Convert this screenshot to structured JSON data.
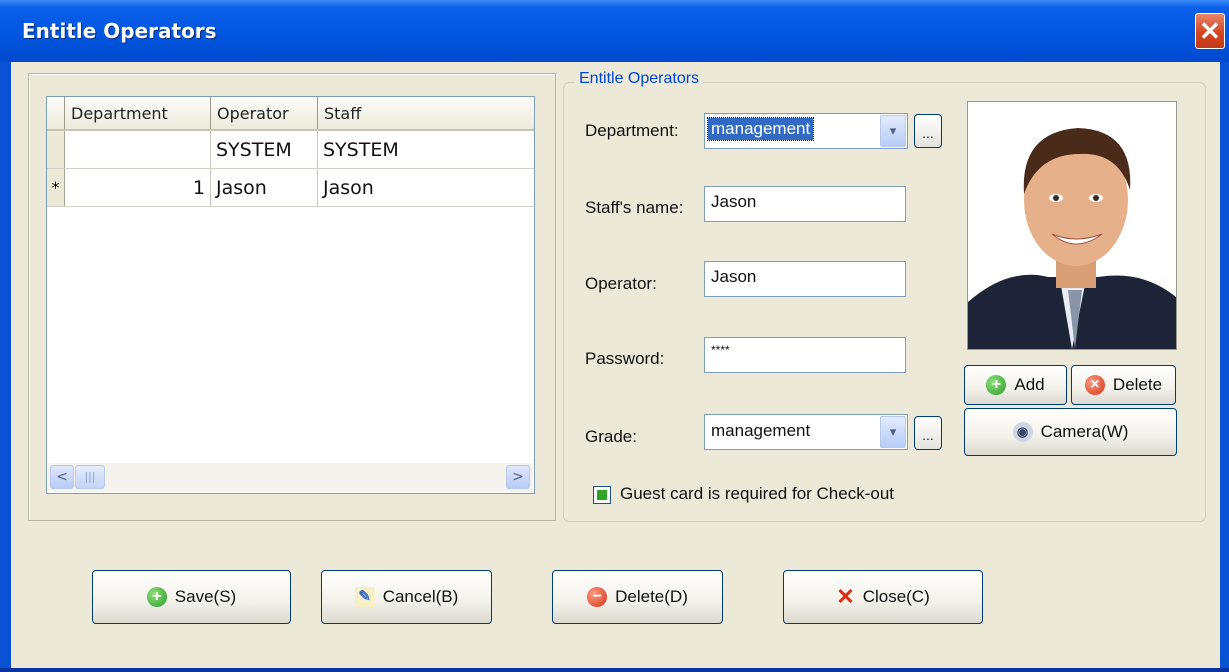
{
  "window": {
    "title": "Entitle Operators",
    "close_glyph": "✕"
  },
  "grid": {
    "columns": [
      "Department",
      "Operator",
      "Staff"
    ],
    "rows": [
      {
        "indicator": "",
        "department": "",
        "operator": "SYSTEM",
        "staff": "SYSTEM"
      },
      {
        "indicator": "*",
        "department": "1",
        "operator": "Jason",
        "staff": "Jason"
      }
    ],
    "scroll_left": "<",
    "scroll_right": ">",
    "scroll_thumb": "|||"
  },
  "form": {
    "group_title": "Entitle Operators",
    "department_label": "Department:",
    "department_value": "management",
    "staff_name_label": "Staff's name:",
    "staff_name_value": "Jason",
    "operator_label": "Operator:",
    "operator_value": "Jason",
    "password_label": "Password:",
    "password_value": "****",
    "grade_label": "Grade:",
    "grade_value": "management",
    "ellipsis": "...",
    "dropdown_glyph": "▾",
    "guest_card_label": "Guest card is required for Check-out",
    "guest_card_checked": true
  },
  "photo_buttons": {
    "add": "Add",
    "delete": "Delete",
    "camera": "Camera(W)"
  },
  "footer": {
    "save": "Save(S)",
    "cancel": "Cancel(B)",
    "delete": "Delete(D)",
    "close": "Close(C)"
  },
  "colors": {
    "titlebar": "#0256e0",
    "client_bg": "#ece9d8",
    "group_title": "#0046d5",
    "selection": "#316ac5"
  }
}
